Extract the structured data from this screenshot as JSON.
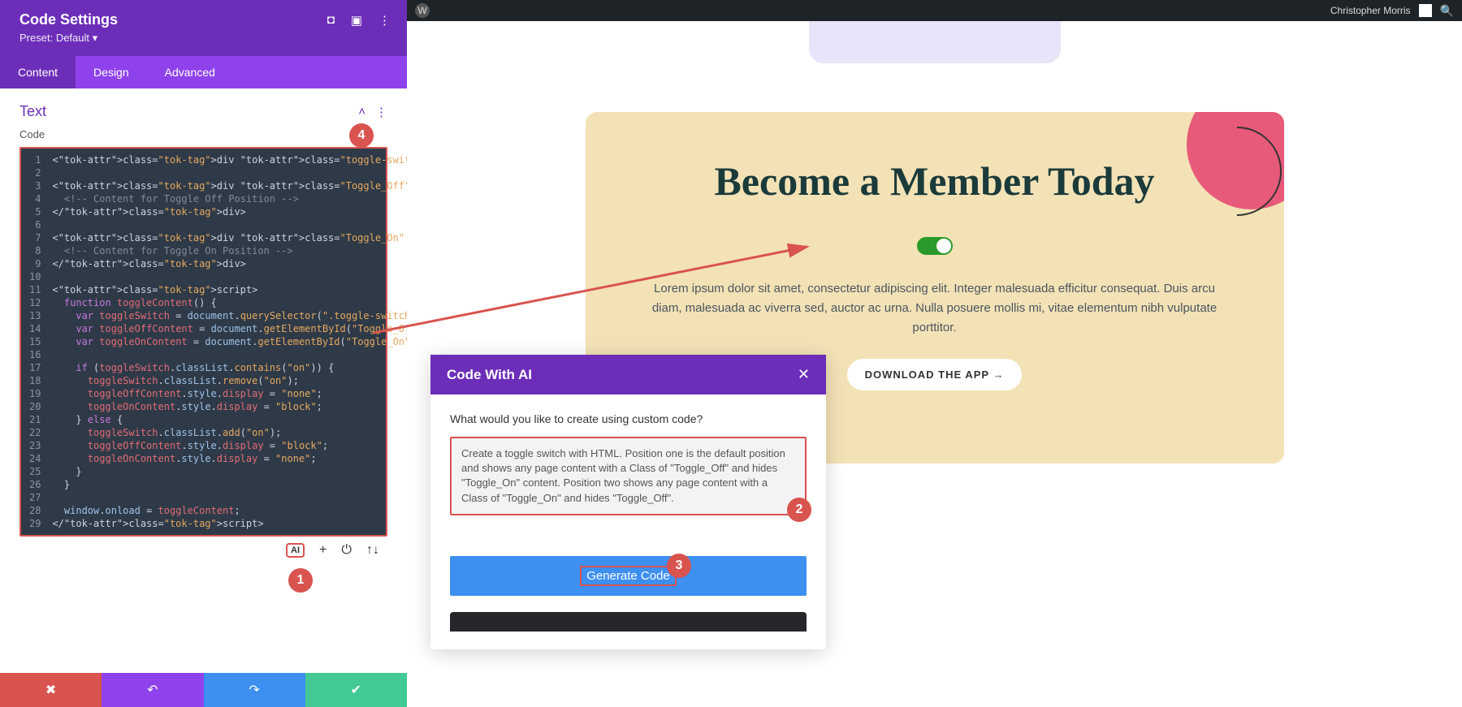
{
  "panel": {
    "title": "Code Settings",
    "preset_label": "Preset:",
    "preset_value": "Default",
    "tabs": {
      "content": "Content",
      "design": "Design",
      "advanced": "Advanced"
    },
    "section_title": "Text",
    "field_label": "Code",
    "ai_btn": "AI"
  },
  "code": {
    "lines": [
      "<div class=\"toggle-switch on\" onclick=\"toggleContent()\"></div>",
      "",
      "<div class=\"Toggle_Off\">",
      "  <!-- Content for Toggle Off Position -->",
      "</div>",
      "",
      "<div class=\"Toggle_On\" style=\"display: none\">",
      "  <!-- Content for Toggle On Position -->",
      "</div>",
      "",
      "<script>",
      "  function toggleContent() {",
      "    var toggleSwitch = document.querySelector(\".toggle-switch\");",
      "    var toggleOffContent = document.getElementById(\"Toggle_Off\");",
      "    var toggleOnContent = document.getElementById(\"Toggle_On\");",
      "",
      "    if (toggleSwitch.classList.contains(\"on\")) {",
      "      toggleSwitch.classList.remove(\"on\");",
      "      toggleOffContent.style.display = \"none\";",
      "      toggleOnContent.style.display = \"block\";",
      "    } else {",
      "      toggleSwitch.classList.add(\"on\");",
      "      toggleOffContent.style.display = \"block\";",
      "      toggleOnContent.style.display = \"none\";",
      "    }",
      "  }",
      "",
      "  window.onload = toggleContent;",
      "</script>"
    ]
  },
  "admin": {
    "username": "Christopher Morris"
  },
  "hero": {
    "title": "Become a Member Today",
    "paragraph": "Lorem ipsum dolor sit amet, consectetur adipiscing elit. Integer malesuada efficitur consequat. Duis arcu diam, malesuada ac viverra sed, auctor ac urna. Nulla posuere mollis mi, vitae elementum nibh vulputate porttitor.",
    "cta": "DOWNLOAD THE APP →"
  },
  "ai": {
    "title": "Code With AI",
    "question": "What would you like to create using custom code?",
    "prompt": "Create a toggle switch with HTML. Position one is the default position and shows any page content with a Class of \"Toggle_Off\" and hides \"Toggle_On\" content. Position two shows any page content with a Class of \"Toggle_On\" and hides \"Toggle_Off\".",
    "generate": "Generate Code"
  },
  "badges": {
    "b1": "1",
    "b2": "2",
    "b3": "3",
    "b4": "4"
  }
}
